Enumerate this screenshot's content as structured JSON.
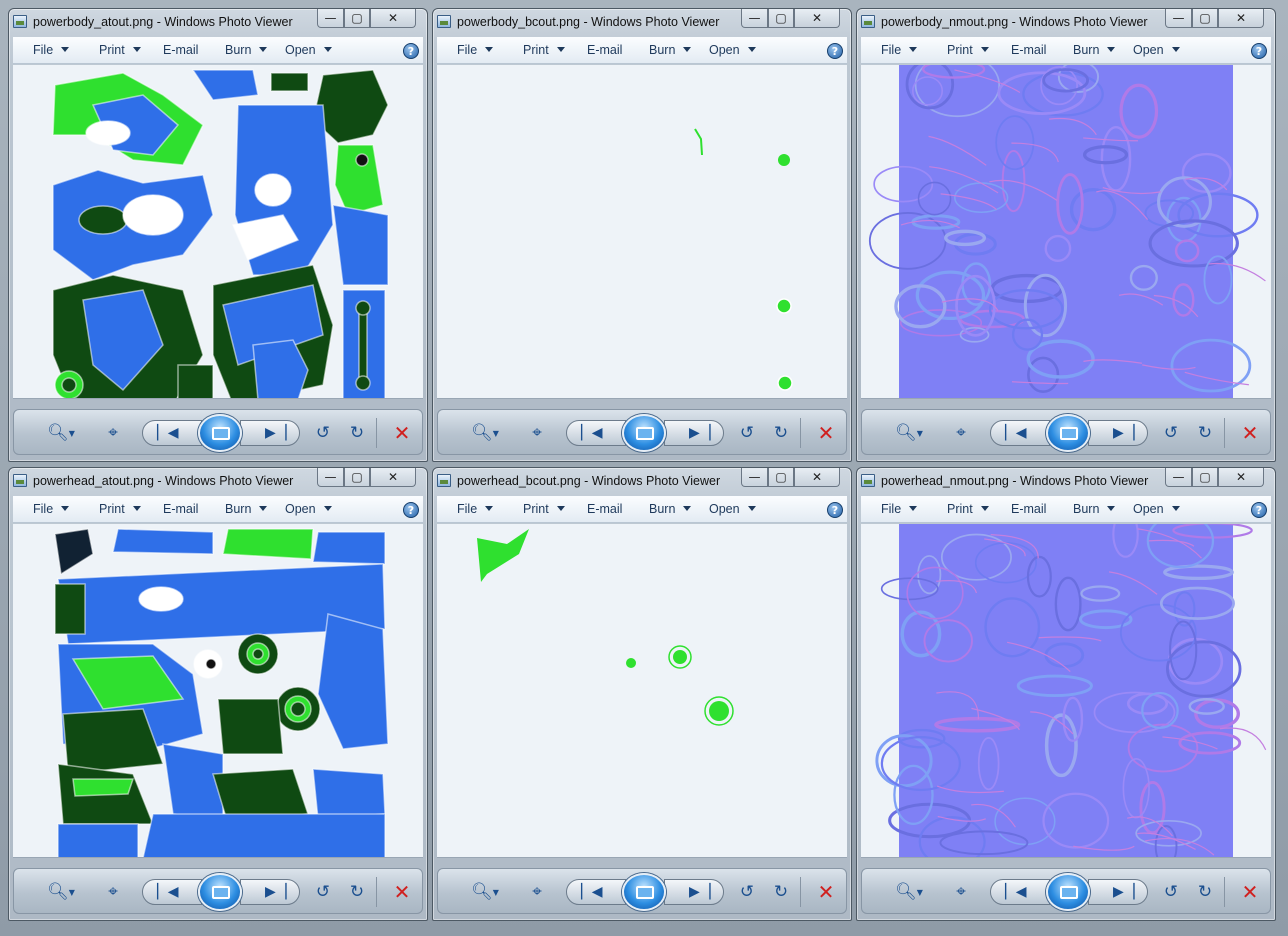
{
  "menu": {
    "file": "File",
    "print": "Print",
    "email": "E-mail",
    "burn": "Burn",
    "open": "Open",
    "help": "?"
  },
  "caption_buttons": {
    "minimize": "—",
    "maximize": "▢",
    "close": "✕"
  },
  "windows": [
    {
      "title": "powerbody_atout.png - Windows Photo Viewer",
      "image": "powerbody-atout"
    },
    {
      "title": "powerbody_bcout.png - Windows Photo Viewer",
      "image": "powerbody-bcout"
    },
    {
      "title": "powerbody_nmout.png - Windows Photo Viewer",
      "image": "powerbody-nmout"
    },
    {
      "title": "powerhead_atout.png - Windows Photo Viewer",
      "image": "powerhead-atout"
    },
    {
      "title": "powerhead_bcout.png - Windows Photo Viewer",
      "image": "powerhead-bcout"
    },
    {
      "title": "powerhead_nmout.png - Windows Photo Viewer",
      "image": "powerhead-nmout"
    }
  ],
  "controls": {
    "zoom_icon": "magnifier-icon",
    "actual_size_icon": "actual-size-icon",
    "previous_icon": "previous-icon",
    "slideshow_icon": "slideshow-icon",
    "next_icon": "next-icon",
    "rotate_ccw_icon": "rotate-counterclockwise-icon",
    "rotate_cw_icon": "rotate-clockwise-icon",
    "delete_icon": "delete-icon"
  },
  "colors": {
    "albedo_green": "#2fe02f",
    "albedo_blue": "#2f6fe8",
    "albedo_dark": "#0f4a12",
    "normal_bg": "#7f80f5",
    "viewer_bg": "#eef3f8"
  }
}
